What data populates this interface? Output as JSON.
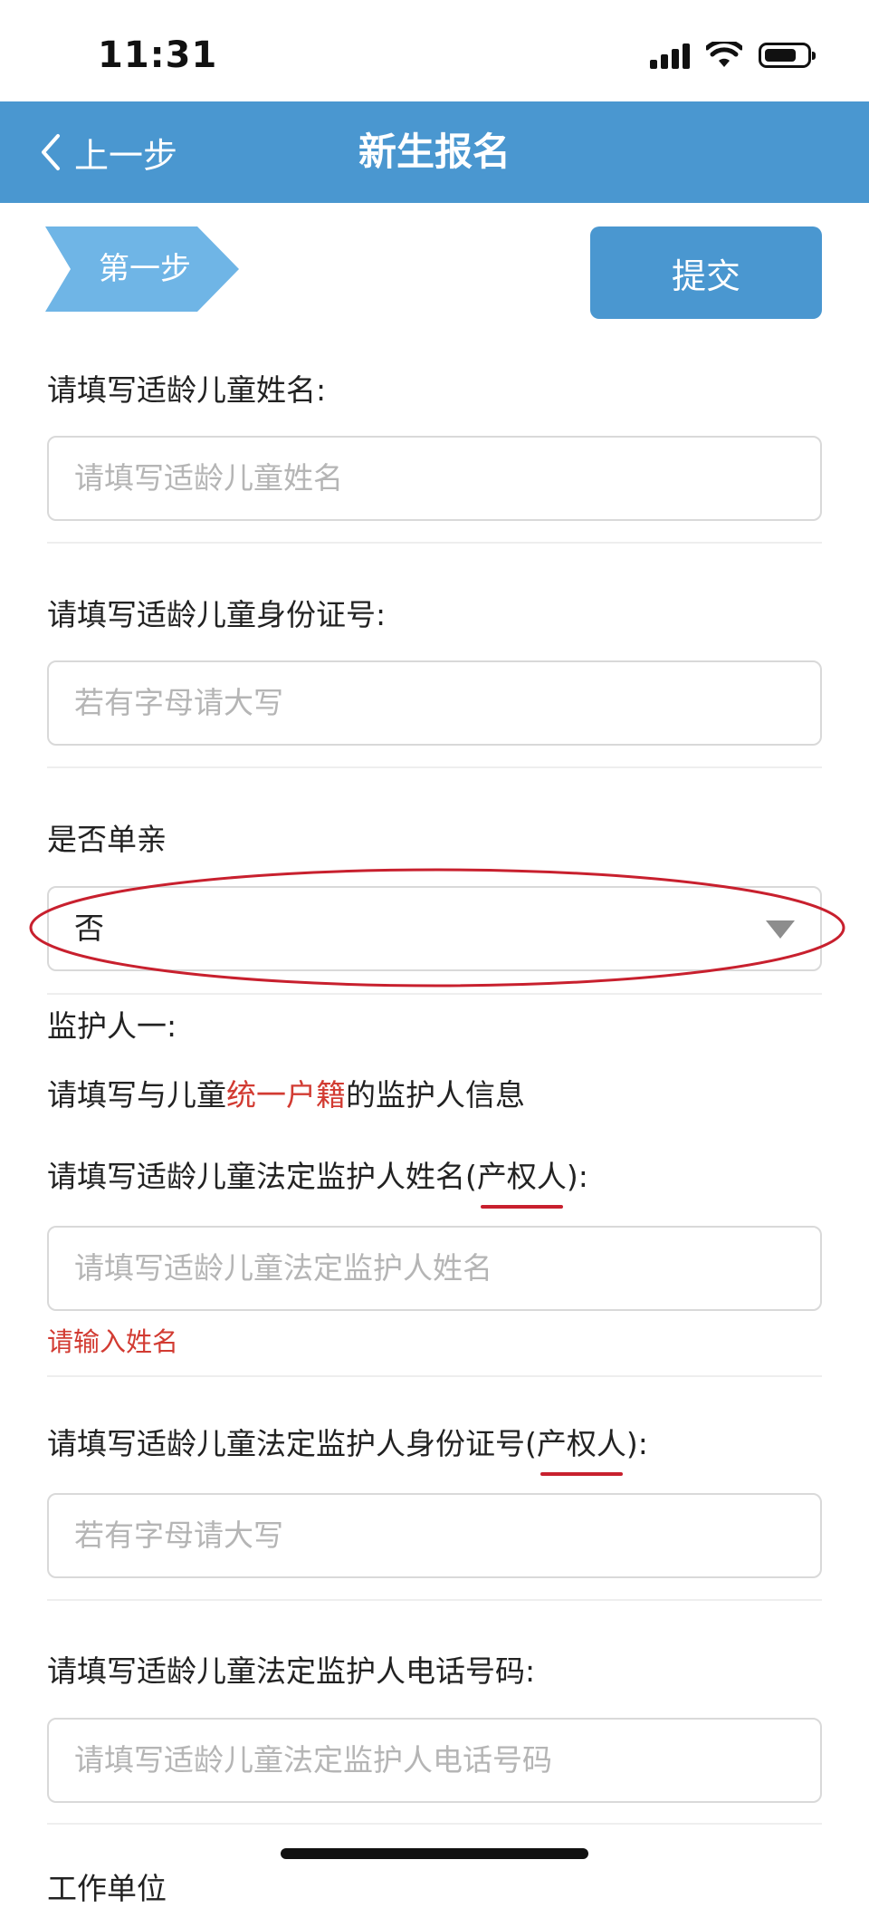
{
  "status": {
    "time": "11:31",
    "icons": [
      "signal-icon",
      "wifi-icon",
      "battery-icon"
    ]
  },
  "nav": {
    "back_label": "上一步",
    "title": "新生报名"
  },
  "step": {
    "label": "第一步"
  },
  "submit_label": "提交",
  "colors": {
    "primary": "#4a97d0",
    "error": "#d23b32",
    "annotation": "#c8202e"
  },
  "form": {
    "child_name": {
      "label": "请填写适龄儿童姓名:",
      "placeholder": "请填写适龄儿童姓名",
      "value": ""
    },
    "child_id": {
      "label": "请填写适龄儿童身份证号:",
      "placeholder": "若有字母请大写",
      "value": ""
    },
    "single_parent": {
      "label": "是否单亲",
      "value": "否"
    },
    "guardian_one": {
      "header": "监护人一:",
      "note": {
        "before": "请填写与儿童",
        "highlight": "统一户籍",
        "after": "的监护人信息"
      },
      "name": {
        "label_before": "请填写适龄儿童法定监护人姓名(",
        "label_highlight": "产权人",
        "label_after": "):",
        "placeholder": "请填写适龄儿童法定监护人姓名",
        "value": "",
        "error": "请输入姓名"
      },
      "id": {
        "label_before": "请填写适龄儿童法定监护人身份证号(",
        "label_highlight": "产权人",
        "label_after": "):",
        "placeholder": "若有字母请大写",
        "value": ""
      },
      "phone": {
        "label": "请填写适龄儿童法定监护人电话号码:",
        "placeholder": "请填写适龄儿童法定监护人电话号码",
        "value": ""
      },
      "work_unit": {
        "label": "工作单位"
      }
    }
  }
}
